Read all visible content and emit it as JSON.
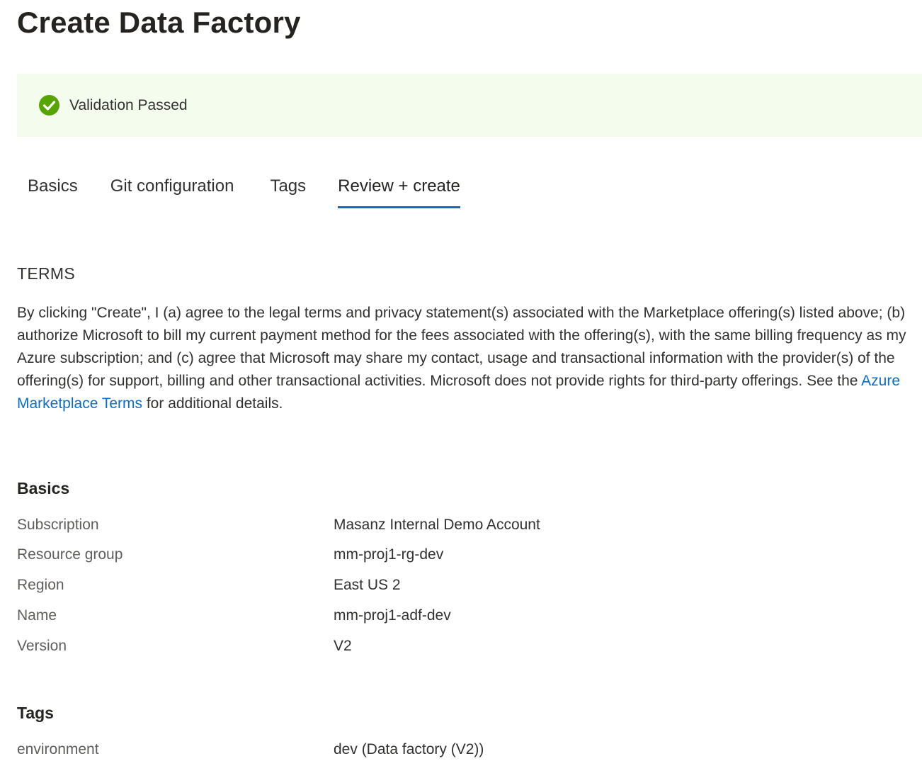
{
  "page": {
    "title": "Create Data Factory"
  },
  "validation": {
    "icon": "check-circle-icon",
    "text": "Validation Passed",
    "color": "#57a300"
  },
  "tabs": [
    {
      "label": "Basics",
      "active": false
    },
    {
      "label": "Git configuration",
      "active": false
    },
    {
      "label": "Tags",
      "active": false
    },
    {
      "label": "Review + create",
      "active": true
    }
  ],
  "terms": {
    "heading": "TERMS",
    "body_before_link": "By clicking \"Create\", I (a) agree to the legal terms and privacy statement(s) associated with the Marketplace offering(s) listed above; (b) authorize Microsoft to bill my current payment method for the fees associated with the offering(s), with the same billing frequency as my Azure subscription; and (c) agree that Microsoft may share my contact, usage and transactional information with the provider(s) of the offering(s) for support, billing and other transactional activities. Microsoft does not provide rights for third-party offerings. See the ",
    "link_text": "Azure Marketplace Terms",
    "body_after_link": " for additional details."
  },
  "basics": {
    "heading": "Basics",
    "rows": [
      {
        "label": "Subscription",
        "value": "Masanz Internal Demo Account"
      },
      {
        "label": "Resource group",
        "value": "mm-proj1-rg-dev"
      },
      {
        "label": "Region",
        "value": "East US 2"
      },
      {
        "label": "Name",
        "value": "mm-proj1-adf-dev"
      },
      {
        "label": "Version",
        "value": "V2"
      }
    ]
  },
  "tags": {
    "heading": "Tags",
    "rows": [
      {
        "label": "environment",
        "value": "dev (Data factory (V2))"
      }
    ]
  },
  "colors": {
    "accent": "#0f6cbd",
    "banner_background": "#f4fcee",
    "success": "#57a300"
  }
}
